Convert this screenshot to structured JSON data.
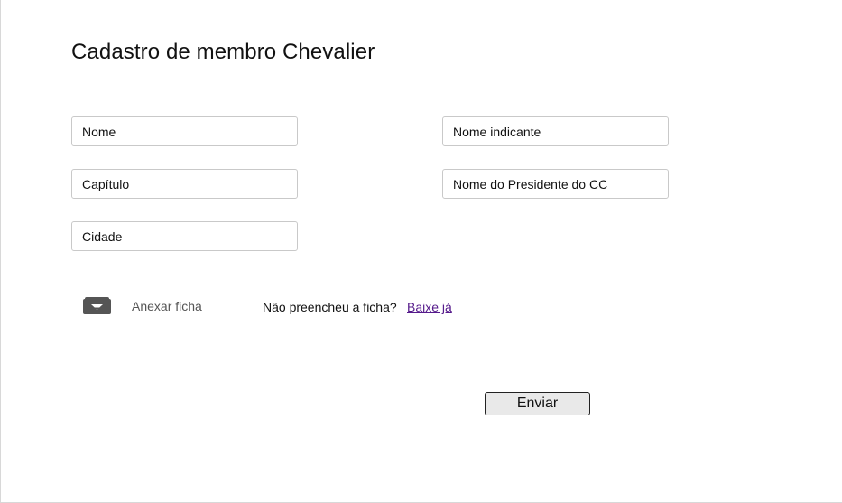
{
  "page": {
    "title": "Cadastro de membro Chevalier"
  },
  "form": {
    "left_fields": [
      {
        "placeholder": "Nome",
        "value": ""
      },
      {
        "placeholder": "Capítulo",
        "value": ""
      },
      {
        "placeholder": "Cidade",
        "value": ""
      }
    ],
    "right_fields": [
      {
        "placeholder": "Nome indicante",
        "value": ""
      },
      {
        "placeholder": "Nome do Presidente do CC",
        "value": ""
      }
    ]
  },
  "attachment": {
    "icon": "download-tray-icon",
    "label": "Anexar ficha"
  },
  "download": {
    "question": "Não preencheu a ficha?",
    "link_text": "Baixe já"
  },
  "submit": {
    "label": "Enviar"
  },
  "colors": {
    "link": "#551a8b",
    "icon": "#555555",
    "field_border": "#c9c9c9",
    "button_background": "#e9e9e9"
  }
}
